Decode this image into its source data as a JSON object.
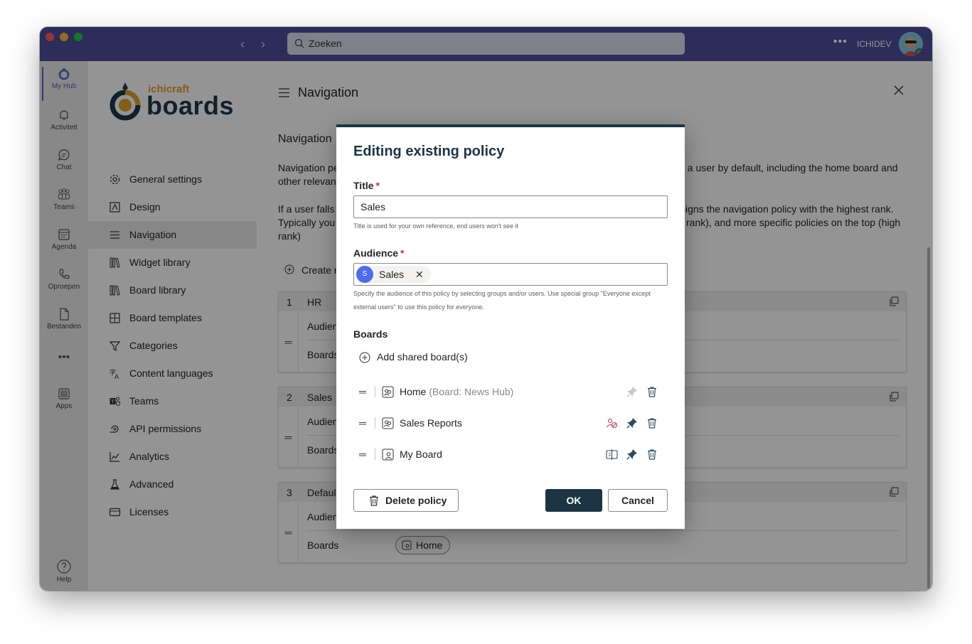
{
  "titlebar": {
    "search_placeholder": "Zoeken",
    "org_name": "ICHIDEV"
  },
  "rail": {
    "items": [
      {
        "label": "My Hub"
      },
      {
        "label": "Activiteit"
      },
      {
        "label": "Chat"
      },
      {
        "label": "Teams"
      },
      {
        "label": "Agenda"
      },
      {
        "label": "Oproepen"
      },
      {
        "label": "Bestanden"
      },
      {
        "label": "Apps"
      }
    ],
    "help": "Help"
  },
  "logo": {
    "small": "ichicraft",
    "big": "boards"
  },
  "sidebar": {
    "items": [
      {
        "label": "General settings",
        "icon": "gear-icon"
      },
      {
        "label": "Design",
        "icon": "design-icon"
      },
      {
        "label": "Navigation",
        "icon": "navigation-icon"
      },
      {
        "label": "Widget library",
        "icon": "library-icon"
      },
      {
        "label": "Board library",
        "icon": "library-icon"
      },
      {
        "label": "Board templates",
        "icon": "template-icon"
      },
      {
        "label": "Categories",
        "icon": "filter-icon"
      },
      {
        "label": "Content languages",
        "icon": "language-icon"
      },
      {
        "label": "Teams",
        "icon": "teams-icon"
      },
      {
        "label": "API permissions",
        "icon": "api-icon"
      },
      {
        "label": "Analytics",
        "icon": "analytics-icon"
      },
      {
        "label": "Advanced",
        "icon": "flask-icon"
      },
      {
        "label": "Licenses",
        "icon": "license-icon"
      }
    ]
  },
  "main": {
    "title": "Navigation",
    "section_title": "Navigation",
    "para1_left": "Navigation pe",
    "para1_left2": "other relevan",
    "para1_right": "f a user by default, including the home board and",
    "para2_left": "If a user falls",
    "para2_left2": "Typically you",
    "para2_left3": "rank)",
    "para2_right": "signs the navigation policy with the highest rank.",
    "para2_right2": "rank), and more specific policies on the top (high",
    "create_label": "Create n",
    "policies": [
      {
        "num": "1",
        "name": "HR"
      },
      {
        "num": "2",
        "name": "Sales"
      },
      {
        "num": "3",
        "name": "Defaul"
      }
    ],
    "row_audience": "Audien",
    "row_boards": "Boards",
    "home_chip": "Home"
  },
  "dialog": {
    "title": "Editing existing policy",
    "title_label": "Title",
    "title_value": "Sales",
    "title_hint": "Title is used for your own reference, end users won't see it",
    "audience_label": "Audience",
    "audience_chip": "Sales",
    "audience_initial": "S",
    "audience_hint": "Specify the audience of this policy by selecting groups and/or users. Use special group \"Everyone except external users\" to use this policy for everyone.",
    "boards_label": "Boards",
    "add_shared": "Add shared board(s)",
    "boards": [
      {
        "name": "Home",
        "suffix": "(Board: News Hub)"
      },
      {
        "name": "Sales Reports",
        "suffix": ""
      },
      {
        "name": "My Board",
        "suffix": ""
      }
    ],
    "delete_label": "Delete policy",
    "ok_label": "OK",
    "cancel_label": "Cancel",
    "required_mark": "*"
  },
  "colors": {
    "teams_purple": "#4d4f9c",
    "dialog_navy": "#1b3545",
    "required": "#c4314b",
    "pin_active": "#2d4a5e",
    "icon_red": "#c4314b"
  }
}
